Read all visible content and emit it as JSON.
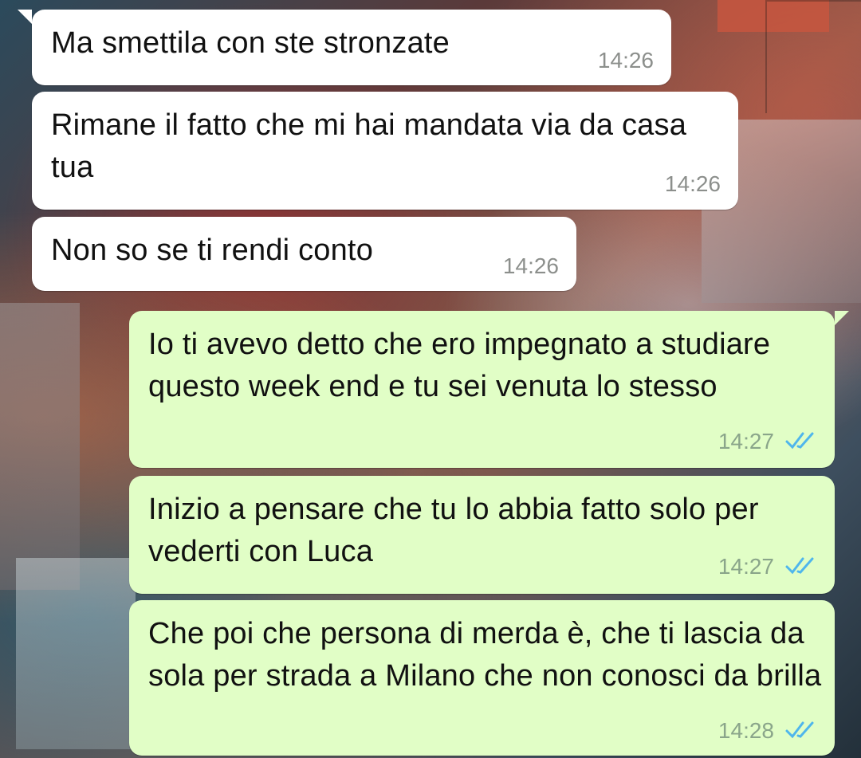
{
  "messages": [
    {
      "direction": "incoming",
      "text": "Ma smettila con ste stronzate",
      "time": "14:26"
    },
    {
      "direction": "incoming",
      "text": "Rimane il fatto che mi hai mandata via da casa tua",
      "time": "14:26"
    },
    {
      "direction": "incoming",
      "text": "Non so se ti rendi conto",
      "time": "14:26"
    },
    {
      "direction": "outgoing",
      "text": "Io ti avevo detto che ero impegnato a studiare questo week end e tu sei venuta lo stesso",
      "time": "14:27",
      "status": "read"
    },
    {
      "direction": "outgoing",
      "text": "Inizio a pensare che tu lo abbia fatto solo per vederti con Luca",
      "time": "14:27",
      "status": "read"
    },
    {
      "direction": "outgoing",
      "text": "Che poi che persona di merda è, che ti lascia da sola per strada a Milano che non conosci da brilla",
      "time": "14:28",
      "status": "read"
    }
  ],
  "colors": {
    "incoming_bubble": "#ffffff",
    "outgoing_bubble": "#e1fec6",
    "read_ticks": "#4fb6ec"
  },
  "icons": {
    "read_status": "double-check-icon"
  }
}
